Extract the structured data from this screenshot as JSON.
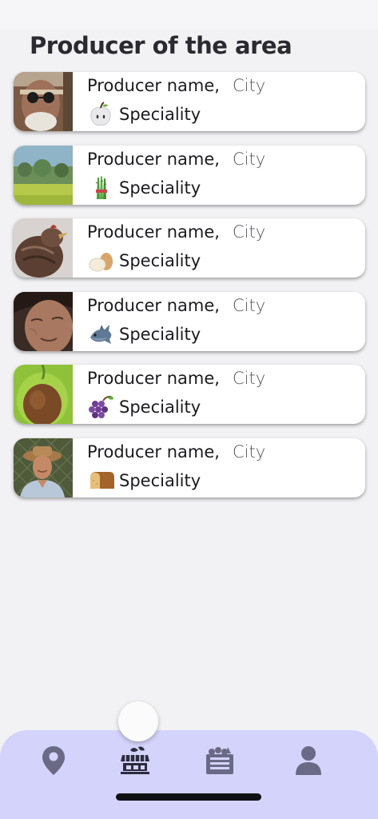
{
  "header": {
    "title": "Producer of the area"
  },
  "producers": [
    {
      "name": "Producer name,",
      "city": "City",
      "speciality": "Speciality",
      "speciality_icon": "apple-icon",
      "photo": "old-man-sunglasses-photo"
    },
    {
      "name": "Producer name,",
      "city": "City",
      "speciality": "Speciality",
      "speciality_icon": "asparagus-icon",
      "photo": "green-field-photo"
    },
    {
      "name": "Producer name,",
      "city": "City",
      "speciality": "Speciality",
      "speciality_icon": "eggs-icon",
      "photo": "hen-photo"
    },
    {
      "name": "Producer name,",
      "city": "City",
      "speciality": "Speciality",
      "speciality_icon": "fish-icon",
      "photo": "old-woman-photo"
    },
    {
      "name": "Producer name,",
      "city": "City",
      "speciality": "Speciality",
      "speciality_icon": "grapes-icon",
      "photo": "avocado-photo"
    },
    {
      "name": "Producer name,",
      "city": "City",
      "speciality": "Speciality",
      "speciality_icon": "bread-icon",
      "photo": "farmer-hat-photo"
    }
  ],
  "bottom_nav": {
    "items": [
      {
        "icon": "map-pin-icon",
        "active": false
      },
      {
        "icon": "market-stall-icon",
        "active": true
      },
      {
        "icon": "produce-crate-icon",
        "active": false
      },
      {
        "icon": "user-icon",
        "active": false
      }
    ],
    "background": "#d4d3fb",
    "icon_color": "#6b6a86",
    "active_icon_color": "#2d2c3e"
  }
}
